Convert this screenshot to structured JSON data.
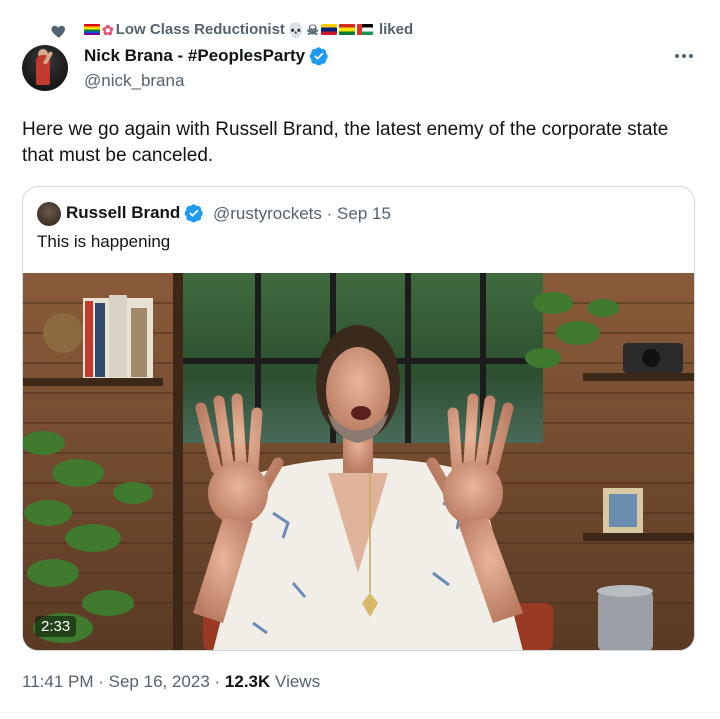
{
  "social_context": {
    "name": "Low Class Reductionist",
    "action": "liked"
  },
  "author": {
    "name": "Nick Brana - #PeoplesParty",
    "handle": "@nick_brana",
    "verified": true
  },
  "tweet": {
    "text": "Here we go again with Russell Brand, the latest enemy of the corporate state that must be canceled."
  },
  "quoted_tweet": {
    "name": "Russell Brand",
    "verified": true,
    "handle": "@rustyrockets",
    "separator": "·",
    "date": "Sep 15",
    "text": "This is happening",
    "video_duration": "2:33"
  },
  "footer": {
    "time": "11:41 PM",
    "date": "Sep 16, 2023",
    "views_count": "12.3K",
    "views_label": "Views"
  },
  "icons": {
    "like": "heart-icon",
    "verified": "verified-badge-icon",
    "more": "more-icon"
  },
  "colors": {
    "verified_blue": "#1d9bf0",
    "secondary_text": "#536471",
    "primary_text": "#0f1419"
  }
}
